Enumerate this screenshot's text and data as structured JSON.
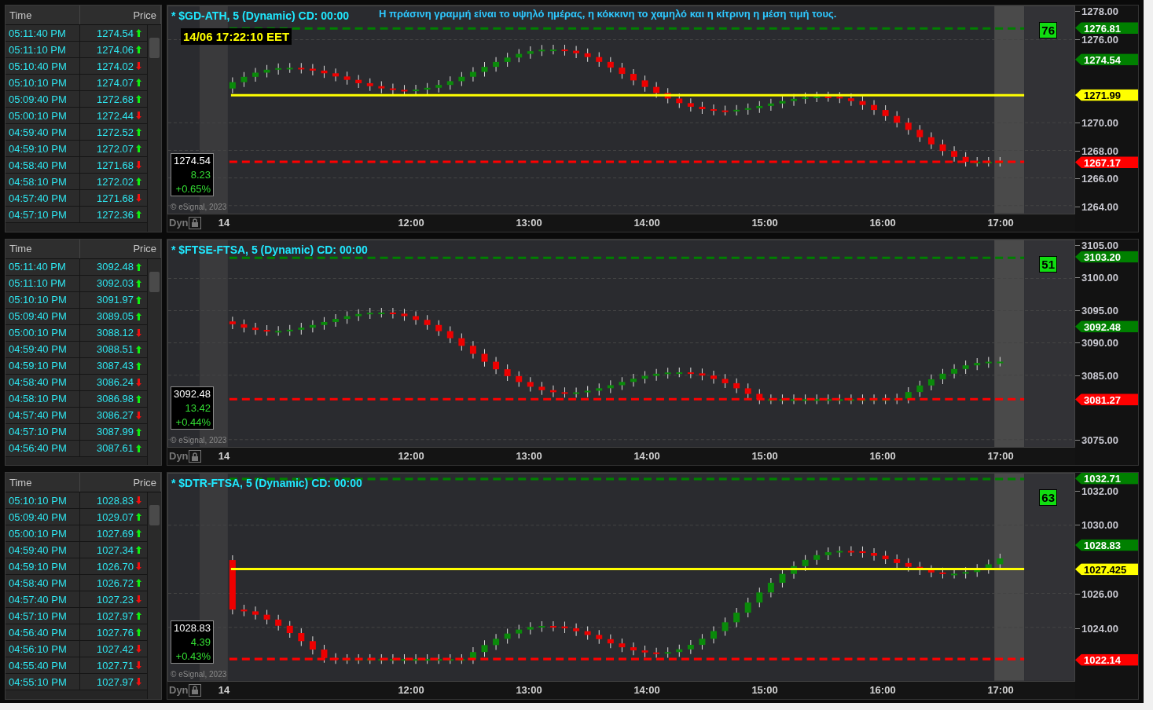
{
  "panels": [
    {
      "table": {
        "columns": [
          "Time",
          "Price"
        ],
        "rows": [
          {
            "time": "05:11:40 PM",
            "price": "1274.54",
            "rising": true
          },
          {
            "time": "05:11:10 PM",
            "price": "1274.06",
            "rising": true
          },
          {
            "time": "05:10:40 PM",
            "price": "1274.02",
            "rising": false
          },
          {
            "time": "05:10:10 PM",
            "price": "1274.07",
            "rising": true
          },
          {
            "time": "05:09:40 PM",
            "price": "1272.68",
            "rising": true
          },
          {
            "time": "05:00:10 PM",
            "price": "1272.44",
            "rising": false
          },
          {
            "time": "04:59:40 PM",
            "price": "1272.52",
            "rising": true
          },
          {
            "time": "04:59:10 PM",
            "price": "1272.07",
            "rising": true
          },
          {
            "time": "04:58:40 PM",
            "price": "1271.68",
            "rising": false
          },
          {
            "time": "04:58:10 PM",
            "price": "1272.02",
            "rising": true
          },
          {
            "time": "04:57:40 PM",
            "price": "1271.68",
            "rising": false
          },
          {
            "time": "04:57:10 PM",
            "price": "1272.36",
            "rising": true
          }
        ]
      },
      "chart": {
        "title": "* $GD-ATH, 5 (Dynamic) CD: 00:00",
        "note": "Η πράσινη γραμμή είναι το υψηλό ημέρας, η κόκκινη το χαμηλό και η κίτρινη η μέση τιμή τους.",
        "datetime": "14/06 17:22:10 EET",
        "score": "76",
        "quote": {
          "last": "1274.54",
          "change": "8.23",
          "percent": "+0.65%"
        },
        "copyright": "© eSignal, 2023",
        "mode": "Dyn",
        "y_ticks": [
          "1278.00",
          "1276.00",
          "1270.00",
          "1268.00",
          "1266.00",
          "1264.00"
        ],
        "tags": [
          {
            "kind": "high",
            "value": "1276.81",
            "color": "#008000"
          },
          {
            "kind": "last",
            "value": "1274.54",
            "color": "#008000"
          },
          {
            "kind": "mid",
            "value": "1271.99",
            "color": "#ffff00"
          },
          {
            "kind": "low",
            "value": "1267.17",
            "color": "#ff0000"
          }
        ],
        "x_ticks": [
          "14",
          "12:00",
          "13:00",
          "14:00",
          "15:00",
          "16:00",
          "17:00"
        ]
      }
    },
    {
      "table": {
        "columns": [
          "Time",
          "Price"
        ],
        "rows": [
          {
            "time": "05:11:40 PM",
            "price": "3092.48",
            "rising": true
          },
          {
            "time": "05:11:10 PM",
            "price": "3092.03",
            "rising": true
          },
          {
            "time": "05:10:10 PM",
            "price": "3091.97",
            "rising": true
          },
          {
            "time": "05:09:40 PM",
            "price": "3089.05",
            "rising": true
          },
          {
            "time": "05:00:10 PM",
            "price": "3088.12",
            "rising": false
          },
          {
            "time": "04:59:40 PM",
            "price": "3088.51",
            "rising": true
          },
          {
            "time": "04:59:10 PM",
            "price": "3087.43",
            "rising": true
          },
          {
            "time": "04:58:40 PM",
            "price": "3086.24",
            "rising": false
          },
          {
            "time": "04:58:10 PM",
            "price": "3086.98",
            "rising": true
          },
          {
            "time": "04:57:40 PM",
            "price": "3086.27",
            "rising": false
          },
          {
            "time": "04:57:10 PM",
            "price": "3087.99",
            "rising": true
          },
          {
            "time": "04:56:40 PM",
            "price": "3087.61",
            "rising": true
          }
        ]
      },
      "chart": {
        "title": "* $FTSE-FTSA, 5 (Dynamic) CD: 00:00",
        "score": "51",
        "quote": {
          "last": "3092.48",
          "change": "13.42",
          "percent": "+0.44%"
        },
        "copyright": "© eSignal, 2023",
        "mode": "Dyn",
        "y_ticks": [
          "3105.00",
          "3100.00",
          "3095.00",
          "3090.00",
          "3085.00",
          "3075.00"
        ],
        "tags": [
          {
            "kind": "high",
            "value": "3103.20",
            "color": "#008000"
          },
          {
            "kind": "last",
            "value": "3092.48",
            "color": "#008000"
          },
          {
            "kind": "low",
            "value": "3081.27",
            "color": "#ff0000"
          }
        ],
        "x_ticks": [
          "14",
          "12:00",
          "13:00",
          "14:00",
          "15:00",
          "16:00",
          "17:00"
        ]
      }
    },
    {
      "table": {
        "columns": [
          "Time",
          "Price"
        ],
        "rows": [
          {
            "time": "05:10:10 PM",
            "price": "1028.83",
            "rising": false
          },
          {
            "time": "05:09:40 PM",
            "price": "1029.07",
            "rising": true
          },
          {
            "time": "05:00:10 PM",
            "price": "1027.69",
            "rising": true
          },
          {
            "time": "04:59:40 PM",
            "price": "1027.34",
            "rising": true
          },
          {
            "time": "04:59:10 PM",
            "price": "1026.70",
            "rising": false
          },
          {
            "time": "04:58:40 PM",
            "price": "1026.72",
            "rising": true
          },
          {
            "time": "04:57:40 PM",
            "price": "1027.23",
            "rising": false
          },
          {
            "time": "04:57:10 PM",
            "price": "1027.97",
            "rising": true
          },
          {
            "time": "04:56:40 PM",
            "price": "1027.76",
            "rising": true
          },
          {
            "time": "04:56:10 PM",
            "price": "1027.42",
            "rising": false
          },
          {
            "time": "04:55:40 PM",
            "price": "1027.71",
            "rising": false
          },
          {
            "time": "04:55:10 PM",
            "price": "1027.97",
            "rising": false
          }
        ]
      },
      "chart": {
        "title": "* $DTR-FTSA, 5 (Dynamic) CD: 00:00",
        "score": "63",
        "quote": {
          "last": "1028.83",
          "change": "4.39",
          "percent": "+0.43%"
        },
        "copyright": "© eSignal, 2023",
        "mode": "Dyn",
        "y_ticks": [
          "1032.00",
          "1030.00",
          "1026.00",
          "1024.00"
        ],
        "tags": [
          {
            "kind": "high",
            "value": "1032.71",
            "color": "#008000"
          },
          {
            "kind": "last",
            "value": "1028.83",
            "color": "#008000"
          },
          {
            "kind": "mid",
            "value": "1027.425",
            "color": "#ffff00"
          },
          {
            "kind": "low",
            "value": "1022.14",
            "color": "#ff0000"
          }
        ],
        "x_ticks": [
          "14",
          "12:00",
          "13:00",
          "14:00",
          "15:00",
          "16:00",
          "17:00"
        ]
      }
    }
  ]
}
